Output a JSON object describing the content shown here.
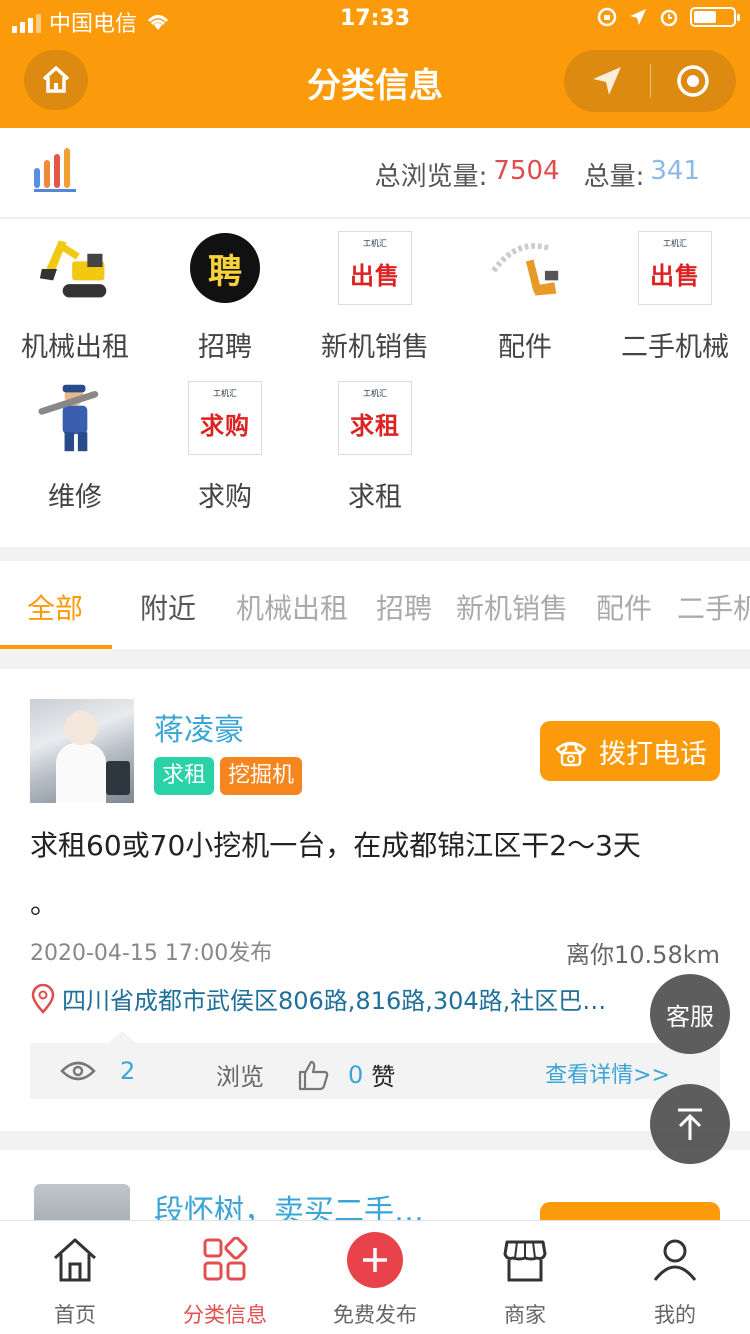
{
  "status_bar": {
    "carrier": "中国电信",
    "time": "17:33"
  },
  "header": {
    "title": "分类信息"
  },
  "stats": {
    "views_label": "总浏览量:",
    "views_value": "7504",
    "total_label": "总量:",
    "total_value": "341"
  },
  "categories": [
    {
      "label": "机械出租",
      "icon": "excavator-icon"
    },
    {
      "label": "招聘",
      "icon": "hiring-poster-icon",
      "poster_text": "聘"
    },
    {
      "label": "新机销售",
      "icon": "sale-poster-icon",
      "poster_brand": "工机汇",
      "poster_text": "出售"
    },
    {
      "label": "配件",
      "icon": "parts-icon"
    },
    {
      "label": "二手机械",
      "icon": "sale-poster-icon",
      "poster_brand": "工机汇",
      "poster_text": "出售"
    },
    {
      "label": "维修",
      "icon": "mechanic-icon"
    },
    {
      "label": "求购",
      "icon": "buy-poster-icon",
      "poster_brand": "工机汇",
      "poster_text": "求购"
    },
    {
      "label": "求租",
      "icon": "rent-poster-icon",
      "poster_brand": "工机汇",
      "poster_text": "求租"
    }
  ],
  "tabs": [
    "全部",
    "附近",
    "机械出租",
    "招聘",
    "新机销售",
    "配件",
    "二手机"
  ],
  "active_tab": 0,
  "post": {
    "name": "蒋凌豪",
    "tags": [
      "求租",
      "挖掘机"
    ],
    "call_label": "拨打电话",
    "content": "求租60或70小挖机一台，在成都锦江区干2～3天",
    "content_tail": "。",
    "date": "2020-04-15 17:00发布",
    "distance": "离你10.58km",
    "address": "四川省成都市武侯区806路,816路,304路,社区巴…",
    "views": "2",
    "views_label": "浏览",
    "likes": "0",
    "likes_label": "赞",
    "detail_link": "查看详情>>"
  },
  "post2": {
    "name": "段怀树，卖买二手…"
  },
  "floating": {
    "service_label": "客服"
  },
  "bottom_nav": [
    {
      "label": "首页",
      "icon": "home-icon"
    },
    {
      "label": "分类信息",
      "icon": "category-icon"
    },
    {
      "label": "免费发布",
      "icon": "publish-icon"
    },
    {
      "label": "商家",
      "icon": "shop-icon"
    },
    {
      "label": "我的",
      "icon": "profile-icon"
    }
  ],
  "colors": {
    "brand_orange": "#fb9b0c",
    "accent_red": "#e34f4f",
    "link_blue": "#3aa5d6"
  }
}
